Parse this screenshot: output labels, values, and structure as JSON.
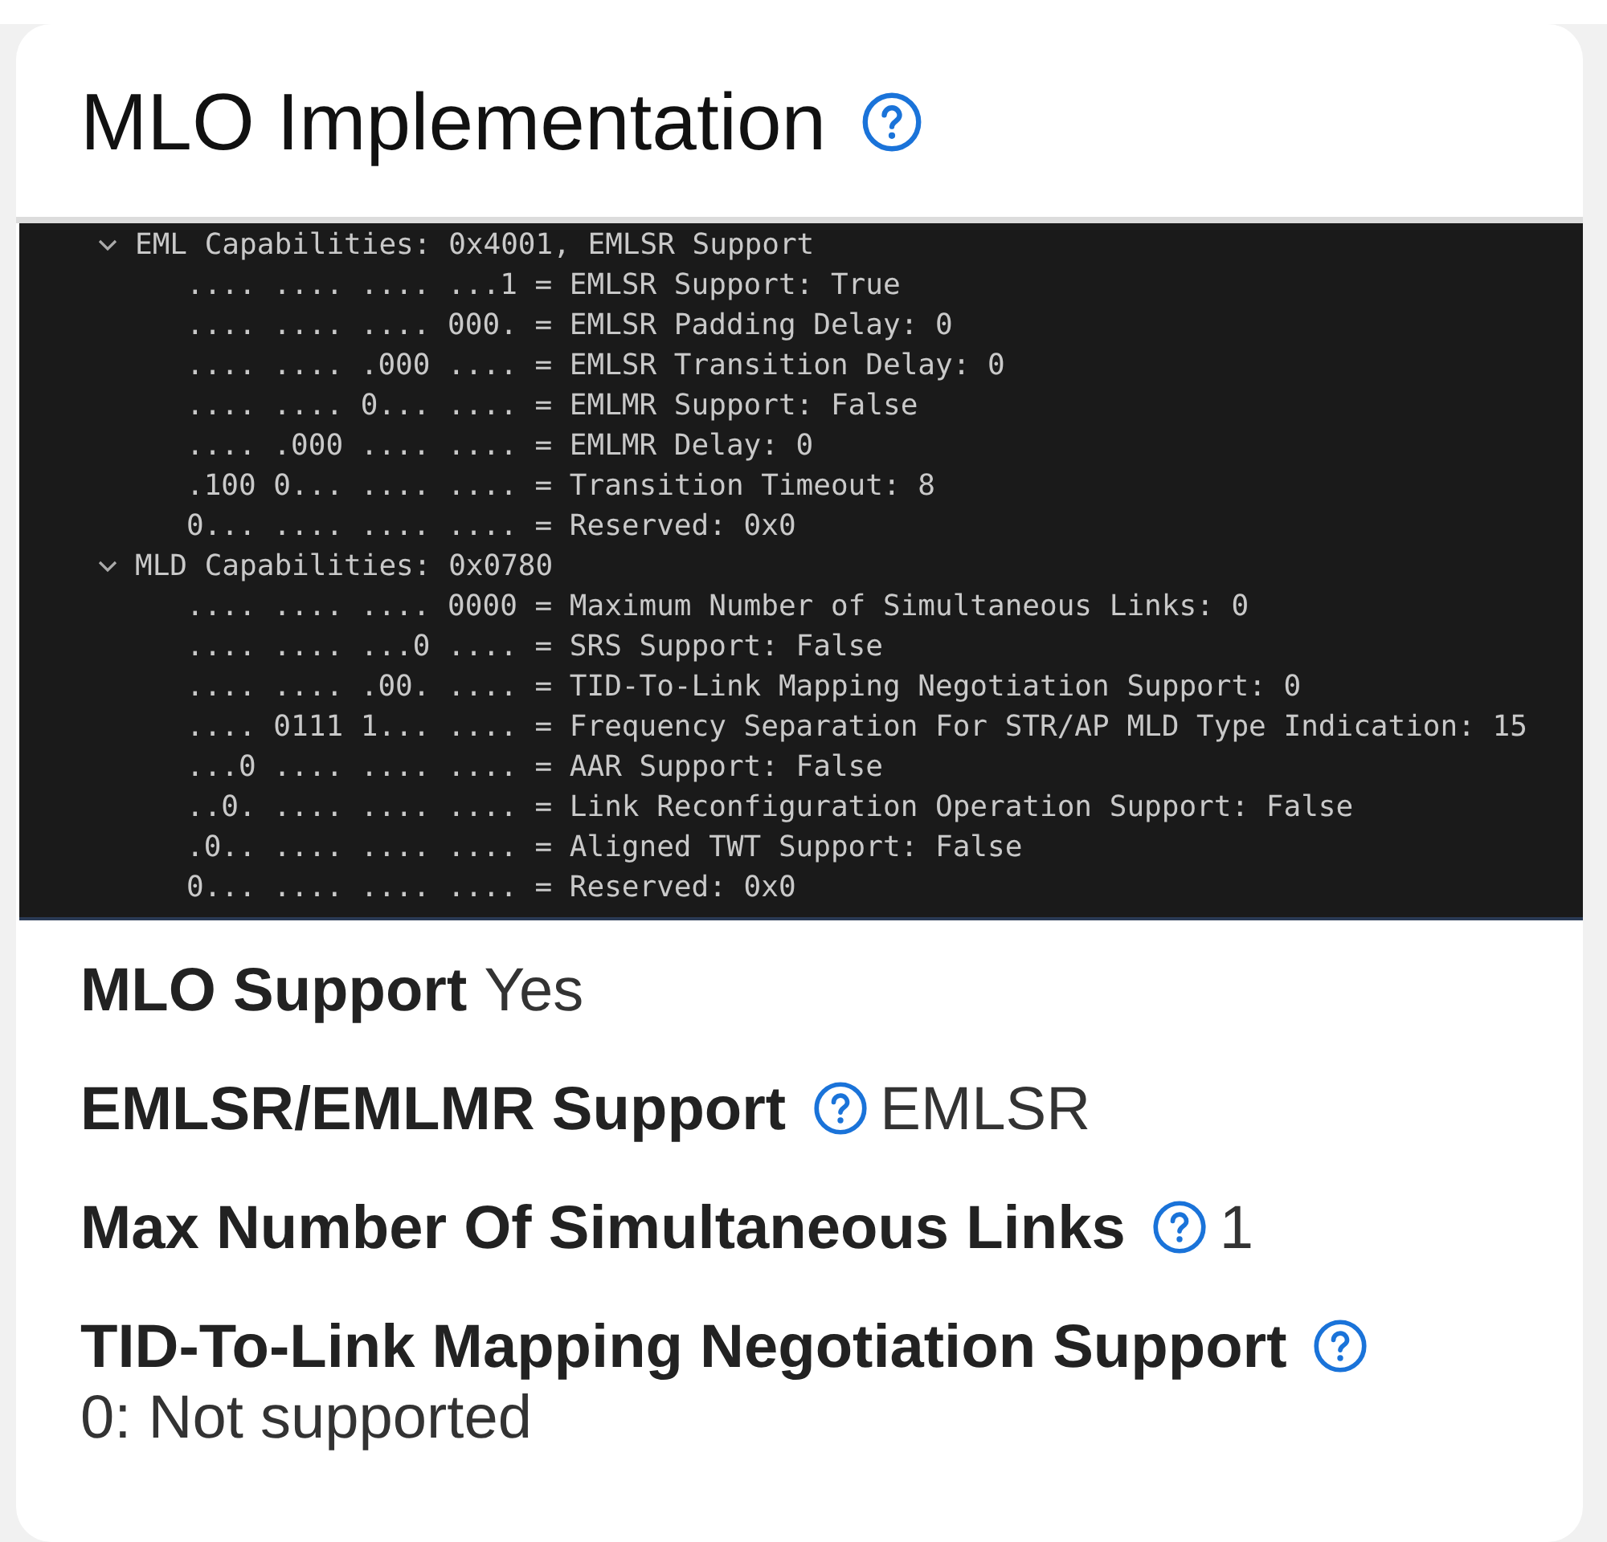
{
  "title": "MLO Implementation",
  "title_help": true,
  "capture": [
    {
      "text": "EML Capabilities: 0x4001, EMLSR Support",
      "expanded": true,
      "children": [
        {
          "text": ".... .... .... ...1 = EMLSR Support: True"
        },
        {
          "text": ".... .... .... 000. = EMLSR Padding Delay: 0"
        },
        {
          "text": ".... .... .000 .... = EMLSR Transition Delay: 0"
        },
        {
          "text": ".... .... 0... .... = EMLMR Support: False"
        },
        {
          "text": ".... .000 .... .... = EMLMR Delay: 0"
        },
        {
          "text": ".100 0... .... .... = Transition Timeout: 8"
        },
        {
          "text": "0... .... .... .... = Reserved: 0x0"
        }
      ]
    },
    {
      "text": "MLD Capabilities: 0x0780",
      "expanded": true,
      "children": [
        {
          "text": ".... .... .... 0000 = Maximum Number of Simultaneous Links: 0"
        },
        {
          "text": ".... .... ...0 .... = SRS Support: False"
        },
        {
          "text": ".... .... .00. .... = TID-To-Link Mapping Negotiation Support: 0"
        },
        {
          "text": ".... 0111 1... .... = Frequency Separation For STR/AP MLD Type Indication: 15"
        },
        {
          "text": "...0 .... .... .... = AAR Support: False"
        },
        {
          "text": "..0. .... .... .... = Link Reconfiguration Operation Support: False"
        },
        {
          "text": ".0.. .... .... .... = Aligned TWT Support: False"
        },
        {
          "text": "0... .... .... .... = Reserved: 0x0"
        }
      ]
    }
  ],
  "fields": [
    {
      "label": "MLO Support",
      "help": false,
      "value": "Yes"
    },
    {
      "label": "EMLSR/EMLMR Support",
      "help": true,
      "value": "EMLSR"
    },
    {
      "label": "Max Number Of Simultaneous Links",
      "help": true,
      "value": "1"
    },
    {
      "label": "TID-To-Link Mapping Negotiation Support",
      "help": true,
      "value": "0: Not supported"
    }
  ]
}
